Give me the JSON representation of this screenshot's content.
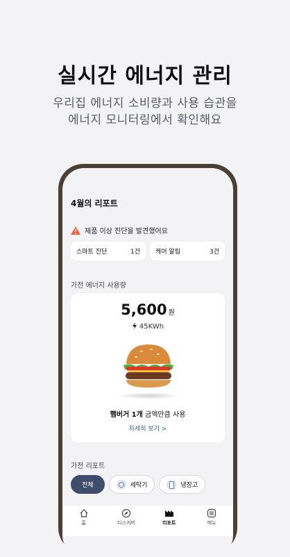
{
  "headline": "실시간 에너지 관리",
  "subtitle_line1": "우리집 에너지 소비량과 사용 습관을",
  "subtitle_line2": "에너지 모니터링에서 확인해요",
  "report": {
    "title": "4월의 리포트",
    "alert_text": "제품 이상 진단을 발견했어요",
    "chips": [
      {
        "label": "스마트 진단",
        "count": "1건"
      },
      {
        "label": "케어 알림",
        "count": "3건"
      }
    ]
  },
  "energy": {
    "section_label": "가전 에너지 사용량",
    "amount": "5,600",
    "unit": "원",
    "kwh": "45KWh",
    "compare_bold": "햄버거 1개",
    "compare_rest": " 금액만큼 사용",
    "detail_link": "자세히 보기 >"
  },
  "appliance": {
    "section_label": "가전 리포트",
    "tabs": [
      "전체",
      "세탁기",
      "냉장고"
    ]
  },
  "nav": [
    "홈",
    "디스커버",
    "리포트",
    "메뉴"
  ],
  "colors": {
    "background": "#f3f3f5",
    "phone_frame": "#4a4038",
    "active_tab": "#3f4c6b",
    "warning": "#e8643c",
    "link": "#2f5c8f"
  },
  "icons": [
    "warning-icon",
    "bolt-icon",
    "hamburger-icon",
    "washer-icon",
    "fridge-icon",
    "home-icon",
    "compass-icon",
    "report-icon",
    "menu-icon"
  ]
}
